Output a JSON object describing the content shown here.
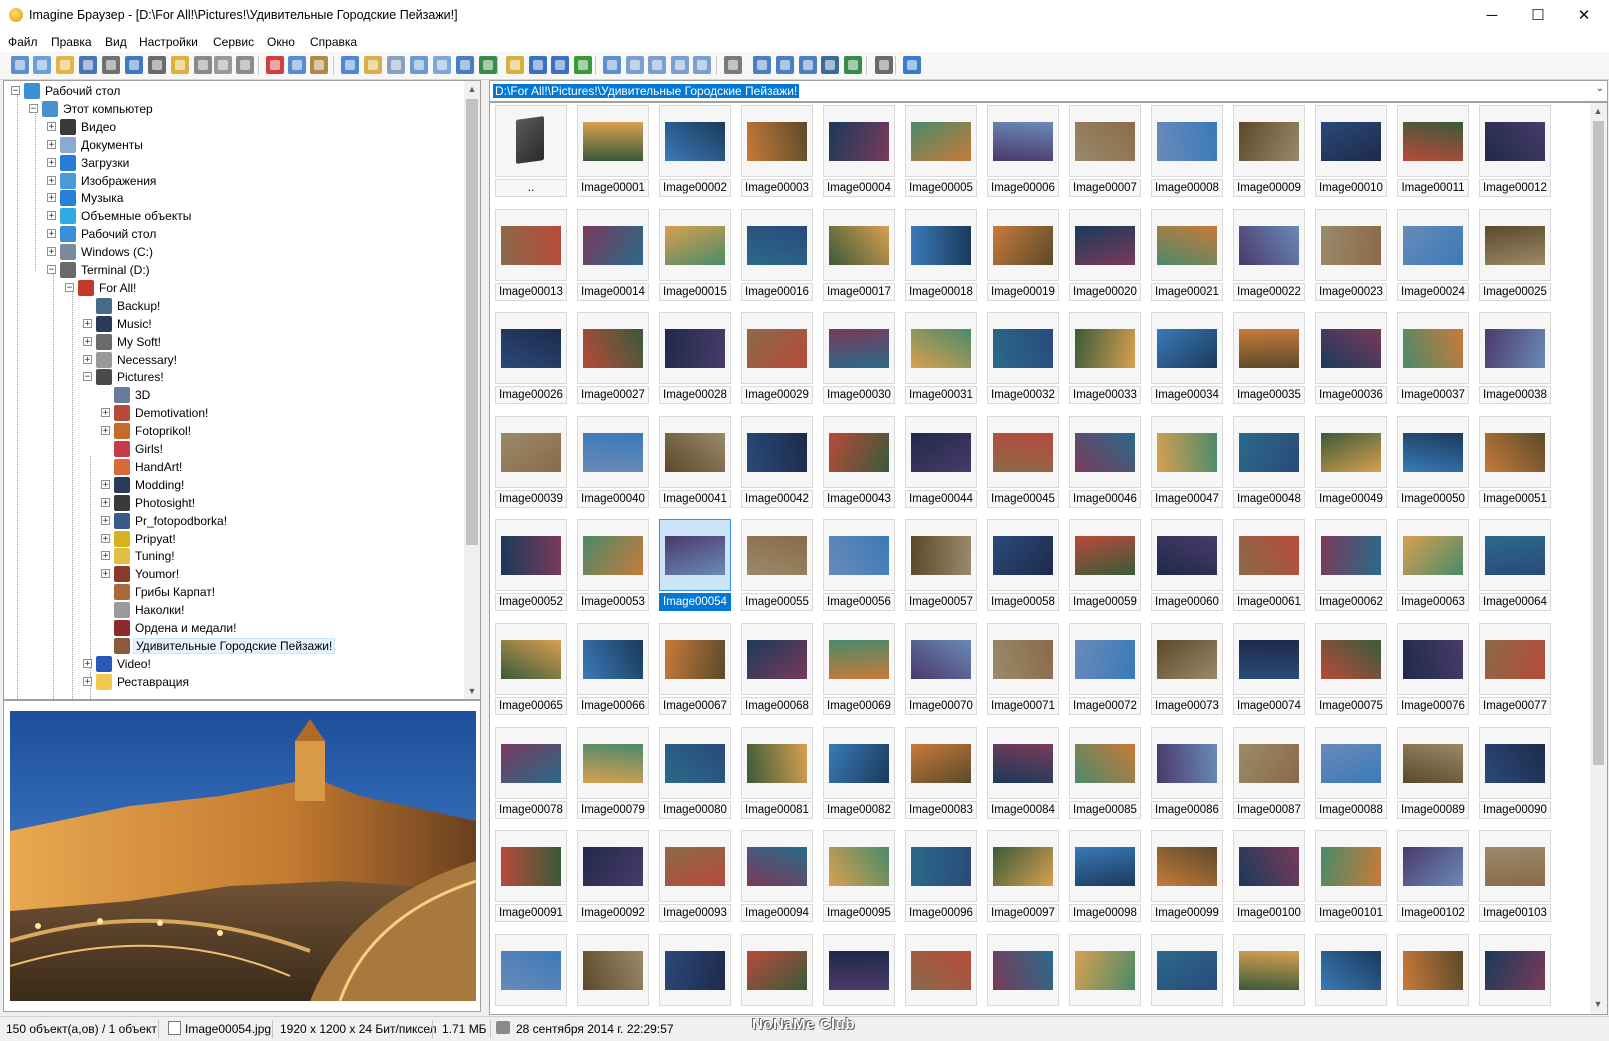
{
  "window": {
    "title": "Imagine Браузер - [D:\\For All!\\Pictures!\\Удивительные Городские Пейзажи!]",
    "min_glyph": "─",
    "max_glyph": "☐",
    "close_glyph": "✕"
  },
  "menu": [
    "Файл",
    "Правка",
    "Вид",
    "Настройки",
    "Сервис",
    "Окно",
    "Справка"
  ],
  "toolbar_icons": [
    {
      "name": "view-icon",
      "color": "#5b8fd0"
    },
    {
      "name": "back-icon",
      "color": "#6aa2d8"
    },
    {
      "name": "open-folder-icon",
      "color": "#e2b547"
    },
    {
      "name": "save-icon",
      "color": "#4a76b8"
    },
    {
      "name": "print-icon",
      "color": "#707070"
    },
    {
      "name": "info-icon",
      "color": "#3f79c4"
    },
    {
      "name": "scan-icon",
      "color": "#6b6b6b"
    },
    {
      "name": "folder-new-icon",
      "color": "#e0b040"
    },
    {
      "name": "rename-icon",
      "color": "#8a8a8a"
    },
    {
      "name": "delete-icon",
      "color": "#9a9a9a"
    },
    {
      "name": "properties-icon",
      "color": "#8b8b8b"
    },
    {
      "name": "cut-icon",
      "color": "#d04040"
    },
    {
      "name": "copy-icon",
      "color": "#5a8ad0"
    },
    {
      "name": "paste-icon",
      "color": "#b08a4a"
    },
    {
      "name": "window-icon",
      "color": "#4d88d0"
    },
    {
      "name": "tree-icon",
      "color": "#d8b048"
    },
    {
      "name": "clock-icon",
      "color": "#8aa0c0"
    },
    {
      "name": "tag-icon",
      "color": "#6a9ad0"
    },
    {
      "name": "grid-small-icon",
      "color": "#7da8d8"
    },
    {
      "name": "grid-large-icon",
      "color": "#4a7ec0"
    },
    {
      "name": "image-view-icon",
      "color": "#3a8a4a"
    },
    {
      "name": "folder-up-icon",
      "color": "#d8b040"
    },
    {
      "name": "arrow-left-icon",
      "color": "#3a70c0"
    },
    {
      "name": "arrow-right-icon",
      "color": "#3a70c0"
    },
    {
      "name": "refresh-icon",
      "color": "#3a9a3a"
    },
    {
      "name": "thumbnails-icon",
      "color": "#5a90d0"
    },
    {
      "name": "details-icon",
      "color": "#7aa0d0"
    },
    {
      "name": "list-icon",
      "color": "#7aa0d0"
    },
    {
      "name": "icons-icon",
      "color": "#7aa0d0"
    },
    {
      "name": "table-icon",
      "color": "#7aa0d0"
    },
    {
      "name": "wrench-icon",
      "color": "#7a7a7a"
    },
    {
      "name": "convert-icon",
      "color": "#4a80c0"
    },
    {
      "name": "batch-icon",
      "color": "#4a80c0"
    },
    {
      "name": "slideshow-icon",
      "color": "#4a80c0"
    },
    {
      "name": "monitor-icon",
      "color": "#3a6a9a"
    },
    {
      "name": "export-icon",
      "color": "#3a8a4a"
    },
    {
      "name": "edit-icon",
      "color": "#6a6a6a"
    },
    {
      "name": "help-icon",
      "color": "#3a7ad0"
    }
  ],
  "tree": [
    {
      "label": "Рабочий стол",
      "level": 0,
      "exp": "-",
      "icon": "desktop-icon",
      "color": "#3a8fd8"
    },
    {
      "label": "Этот компьютер",
      "level": 1,
      "exp": "-",
      "icon": "computer-icon",
      "color": "#4a90d0"
    },
    {
      "label": "Видео",
      "level": 2,
      "exp": "+",
      "icon": "video-folder-icon",
      "color": "#3a3a3a"
    },
    {
      "label": "Документы",
      "level": 2,
      "exp": "+",
      "icon": "documents-icon",
      "color": "#8aaad0"
    },
    {
      "label": "Загрузки",
      "level": 2,
      "exp": "+",
      "icon": "download-icon",
      "color": "#2a7ad8"
    },
    {
      "label": "Изображения",
      "level": 2,
      "exp": "+",
      "icon": "images-folder-icon",
      "color": "#4a9ad8"
    },
    {
      "label": "Музыка",
      "level": 2,
      "exp": "+",
      "icon": "music-icon",
      "color": "#2a80d8"
    },
    {
      "label": "Объемные объекты",
      "level": 2,
      "exp": "+",
      "icon": "3d-objects-icon",
      "color": "#30a8e0"
    },
    {
      "label": "Рабочий стол",
      "level": 2,
      "exp": "+",
      "icon": "desktop-icon",
      "color": "#3a8fd8"
    },
    {
      "label": "Windows (C:)",
      "level": 2,
      "exp": "+",
      "icon": "drive-icon",
      "color": "#7a8a9a"
    },
    {
      "label": "Terminal (D:)",
      "level": 2,
      "exp": "-",
      "icon": "drive-icon",
      "color": "#6a6a6a"
    },
    {
      "label": "For All!",
      "level": 3,
      "exp": "-",
      "icon": "for-all-icon",
      "color": "#c43a2a"
    },
    {
      "label": "Backup!",
      "level": 4,
      "exp": "",
      "icon": "backup-icon",
      "color": "#4a6a8a"
    },
    {
      "label": "Music!",
      "level": 4,
      "exp": "+",
      "icon": "music-folder-icon",
      "color": "#2a3a5a"
    },
    {
      "label": "My Soft!",
      "level": 4,
      "exp": "+",
      "icon": "soft-icon",
      "color": "#6a6a6a"
    },
    {
      "label": "Necessary!",
      "level": 4,
      "exp": "+",
      "icon": "necessary-icon",
      "color": "#9a9a9a"
    },
    {
      "label": "Pictures!",
      "level": 4,
      "exp": "-",
      "icon": "pictures-icon",
      "color": "#4a4a4a"
    },
    {
      "label": "3D",
      "level": 5,
      "exp": "",
      "icon": "3d-icon",
      "color": "#6a7a9a"
    },
    {
      "label": "Demotivation!",
      "level": 5,
      "exp": "+",
      "icon": "demotivation-icon",
      "color": "#b84a3a"
    },
    {
      "label": "Fotoprikol!",
      "level": 5,
      "exp": "+",
      "icon": "fotoprikol-icon",
      "color": "#c86a2a"
    },
    {
      "label": "Girls!",
      "level": 5,
      "exp": "",
      "icon": "girls-icon",
      "color": "#c83a4a"
    },
    {
      "label": "HandArt!",
      "level": 5,
      "exp": "",
      "icon": "handart-icon",
      "color": "#d86a3a"
    },
    {
      "label": "Modding!",
      "level": 5,
      "exp": "+",
      "icon": "modding-icon",
      "color": "#2a3a5a"
    },
    {
      "label": "Photosight!",
      "level": 5,
      "exp": "+",
      "icon": "photosight-icon",
      "color": "#3a3a3a"
    },
    {
      "label": "Pr_fotopodborka!",
      "level": 5,
      "exp": "+",
      "icon": "fotopodborka-icon",
      "color": "#3a5a8a"
    },
    {
      "label": "Pripyat!",
      "level": 5,
      "exp": "+",
      "icon": "radiation-icon",
      "color": "#d8b020"
    },
    {
      "label": "Tuning!",
      "level": 5,
      "exp": "+",
      "icon": "tuning-icon",
      "color": "#e0c040"
    },
    {
      "label": "Youmor!",
      "level": 5,
      "exp": "+",
      "icon": "youmor-icon",
      "color": "#8a3a2a"
    },
    {
      "label": "Грибы Карпат!",
      "level": 5,
      "exp": "",
      "icon": "mushroom-icon",
      "color": "#a86a3a"
    },
    {
      "label": "Наколки!",
      "level": 5,
      "exp": "",
      "icon": "tattoo-icon",
      "color": "#9a9a9a"
    },
    {
      "label": "Ордена и медали!",
      "level": 5,
      "exp": "",
      "icon": "medal-icon",
      "color": "#8a2a2a"
    },
    {
      "label": "Удивительные Городские Пейзажи!",
      "level": 5,
      "exp": "",
      "icon": "city-folder-icon",
      "color": "#8a5a3a",
      "selected": true
    },
    {
      "label": "Video!",
      "level": 4,
      "exp": "+",
      "icon": "video-icon",
      "color": "#2a5ab8"
    },
    {
      "label": "Реставрация",
      "level": 4,
      "exp": "+",
      "icon": "folder-icon",
      "color": "#f0c850"
    }
  ],
  "path_bar": {
    "value": "D:\\For All!\\Pictures!\\Удивительные Городские Пейзажи!",
    "dropdown_glyph": "⌄"
  },
  "thumbnails": {
    "parent_label": "..",
    "selected_index": 54,
    "items": [
      "Image00001",
      "Image00002",
      "Image00003",
      "Image00004",
      "Image00005",
      "Image00006",
      "Image00007",
      "Image00008",
      "Image00009",
      "Image00010",
      "Image00011",
      "Image00012",
      "Image00013",
      "Image00014",
      "Image00015",
      "Image00016",
      "Image00017",
      "Image00018",
      "Image00019",
      "Image00020",
      "Image00021",
      "Image00022",
      "Image00023",
      "Image00024",
      "Image00025",
      "Image00026",
      "Image00027",
      "Image00028",
      "Image00029",
      "Image00030",
      "Image00031",
      "Image00032",
      "Image00033",
      "Image00034",
      "Image00035",
      "Image00036",
      "Image00037",
      "Image00038",
      "Image00039",
      "Image00040",
      "Image00041",
      "Image00042",
      "Image00043",
      "Image00044",
      "Image00045",
      "Image00046",
      "Image00047",
      "Image00048",
      "Image00049",
      "Image00050",
      "Image00051",
      "Image00052",
      "Image00053",
      "Image00054",
      "Image00055",
      "Image00056",
      "Image00057",
      "Image00058",
      "Image00059",
      "Image00060",
      "Image00061",
      "Image00062",
      "Image00063",
      "Image00064",
      "Image00065",
      "Image00066",
      "Image00067",
      "Image00068",
      "Image00069",
      "Image00070",
      "Image00071",
      "Image00072",
      "Image00073",
      "Image00074",
      "Image00075",
      "Image00076",
      "Image00077",
      "Image00078",
      "Image00079",
      "Image00080",
      "Image00081",
      "Image00082",
      "Image00083",
      "Image00084",
      "Image00085",
      "Image00086",
      "Image00087",
      "Image00088",
      "Image00089",
      "Image00090",
      "Image00091",
      "Image00092",
      "Image00093",
      "Image00094",
      "Image00095",
      "Image00096",
      "Image00097",
      "Image00098",
      "Image00099",
      "Image00100",
      "Image00101",
      "Image00102",
      "Image00103",
      "",
      "",
      "",
      "",
      "",
      "",
      "",
      "",
      "",
      "",
      "",
      "",
      ""
    ],
    "palette": [
      "#1e2a4a",
      "#c87a3a",
      "#2a4a7a",
      "#3a5a3a",
      "#6a8ab8",
      "#d8a050",
      "#4a3a6a",
      "#8a6a4a",
      "#1a3a5a",
      "#b84a3a",
      "#3a7ab8",
      "#5a4a2a",
      "#2a6a8a",
      "#9a8a6a",
      "#7a3a5a",
      "#4a8a6a"
    ]
  },
  "status": {
    "count": "150 объект(а,ов) / 1 объект",
    "filename": "Image00054.jpg",
    "dimensions": "1920 x 1200 x 24 Бит/пиксел",
    "size": "1.71 МБ",
    "date": "28 сентября 2014 г. 22:29:57",
    "watermark": "NoNaMe Club"
  },
  "accent_color": "#0078d7"
}
